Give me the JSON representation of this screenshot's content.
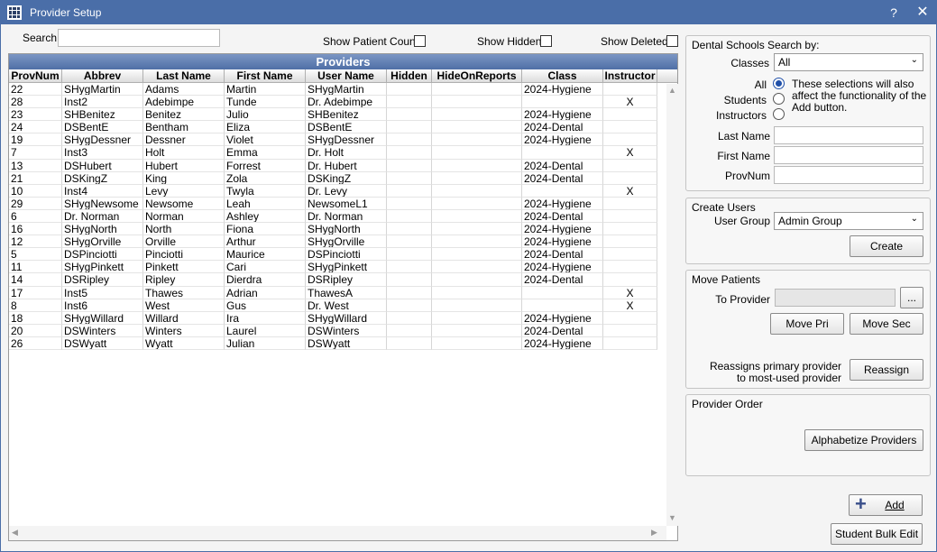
{
  "window": {
    "title": "Provider Setup",
    "help": "?",
    "close": "✕"
  },
  "search": {
    "label": "Search",
    "value": ""
  },
  "options": {
    "show_patient_count": "Show Patient Count",
    "show_hidden": "Show Hidden",
    "show_deleted": "Show Deleted"
  },
  "grid": {
    "title": "Providers",
    "columns": [
      "ProvNum",
      "Abbrev",
      "Last Name",
      "First Name",
      "User Name",
      "Hidden",
      "HideOnReports",
      "Class",
      "Instructor"
    ],
    "rows": [
      [
        "22",
        "SHygMartin",
        "Adams",
        "Martin",
        "SHygMartin",
        "",
        "",
        "2024-Hygiene",
        ""
      ],
      [
        "28",
        "Inst2",
        "Adebimpe",
        "Tunde",
        "Dr. Adebimpe",
        "",
        "",
        "",
        "X"
      ],
      [
        "23",
        "SHBenitez",
        "Benitez",
        "Julio",
        "SHBenitez",
        "",
        "",
        "2024-Hygiene",
        ""
      ],
      [
        "24",
        "DSBentE",
        "Bentham",
        "Eliza",
        "DSBentE",
        "",
        "",
        "2024-Dental",
        ""
      ],
      [
        "19",
        "SHygDessner",
        "Dessner",
        "Violet",
        "SHygDessner",
        "",
        "",
        "2024-Hygiene",
        ""
      ],
      [
        "7",
        "Inst3",
        "Holt",
        "Emma",
        "Dr. Holt",
        "",
        "",
        "",
        "X"
      ],
      [
        "13",
        "DSHubert",
        "Hubert",
        "Forrest",
        "Dr. Hubert",
        "",
        "",
        "2024-Dental",
        ""
      ],
      [
        "21",
        "DSKingZ",
        "King",
        "Zola",
        "DSKingZ",
        "",
        "",
        "2024-Dental",
        ""
      ],
      [
        "10",
        "Inst4",
        "Levy",
        "Twyla",
        "Dr. Levy",
        "",
        "",
        "",
        "X"
      ],
      [
        "29",
        "SHygNewsome",
        "Newsome",
        "Leah",
        "NewsomeL1",
        "",
        "",
        "2024-Hygiene",
        ""
      ],
      [
        "6",
        "Dr. Norman",
        "Norman",
        "Ashley",
        "Dr. Norman",
        "",
        "",
        "2024-Dental",
        ""
      ],
      [
        "16",
        "SHygNorth",
        "North",
        "Fiona",
        "SHygNorth",
        "",
        "",
        "2024-Hygiene",
        ""
      ],
      [
        "12",
        "SHygOrville",
        "Orville",
        "Arthur",
        "SHygOrville",
        "",
        "",
        "2024-Hygiene",
        ""
      ],
      [
        "5",
        "DSPinciotti",
        "Pinciotti",
        "Maurice",
        "DSPinciotti",
        "",
        "",
        "2024-Dental",
        ""
      ],
      [
        "11",
        "SHygPinkett",
        "Pinkett",
        "Cari",
        "SHygPinkett",
        "",
        "",
        "2024-Hygiene",
        ""
      ],
      [
        "14",
        "DSRipley",
        "Ripley",
        "Dierdra",
        "DSRipley",
        "",
        "",
        "2024-Dental",
        ""
      ],
      [
        "17",
        "Inst5",
        "Thawes",
        "Adrian",
        "ThawesA",
        "",
        "",
        "",
        "X"
      ],
      [
        "8",
        "Inst6",
        "West",
        "Gus",
        "Dr. West",
        "",
        "",
        "",
        "X"
      ],
      [
        "18",
        "SHygWillard",
        "Willard",
        "Ira",
        "SHygWillard",
        "",
        "",
        "2024-Hygiene",
        ""
      ],
      [
        "20",
        "DSWinters",
        "Winters",
        "Laurel",
        "DSWinters",
        "",
        "",
        "2024-Dental",
        ""
      ],
      [
        "26",
        "DSWyatt",
        "Wyatt",
        "Julian",
        "DSWyatt",
        "",
        "",
        "2024-Hygiene",
        ""
      ]
    ]
  },
  "dental_schools": {
    "title": "Dental Schools Search by:",
    "classes_label": "Classes",
    "classes_value": "All",
    "radio_all": "All",
    "radio_students": "Students",
    "radio_instructors": "Instructors",
    "note": "These selections will also affect the functionality of the Add button.",
    "last_name_label": "Last Name",
    "first_name_label": "First Name",
    "provnum_label": "ProvNum"
  },
  "create_users": {
    "title": "Create Users",
    "user_group_label": "User Group",
    "user_group_value": "Admin Group",
    "create_button": "Create"
  },
  "move_patients": {
    "title": "Move Patients",
    "to_provider_label": "To Provider",
    "browse_button": "...",
    "move_pri_button": "Move Pri",
    "move_sec_button": "Move Sec",
    "reassign_note": "Reassigns primary provider to most-used provider",
    "reassign_button": "Reassign"
  },
  "provider_order": {
    "title": "Provider Order",
    "alphabetize_button": "Alphabetize Providers"
  },
  "footer": {
    "add_button": "Add",
    "student_bulk_edit_button": "Student Bulk Edit"
  },
  "colors": {
    "titlebar": "#4a6ea8",
    "grid_header": "#5d7db2",
    "add_icon": "#3a4f8a"
  }
}
